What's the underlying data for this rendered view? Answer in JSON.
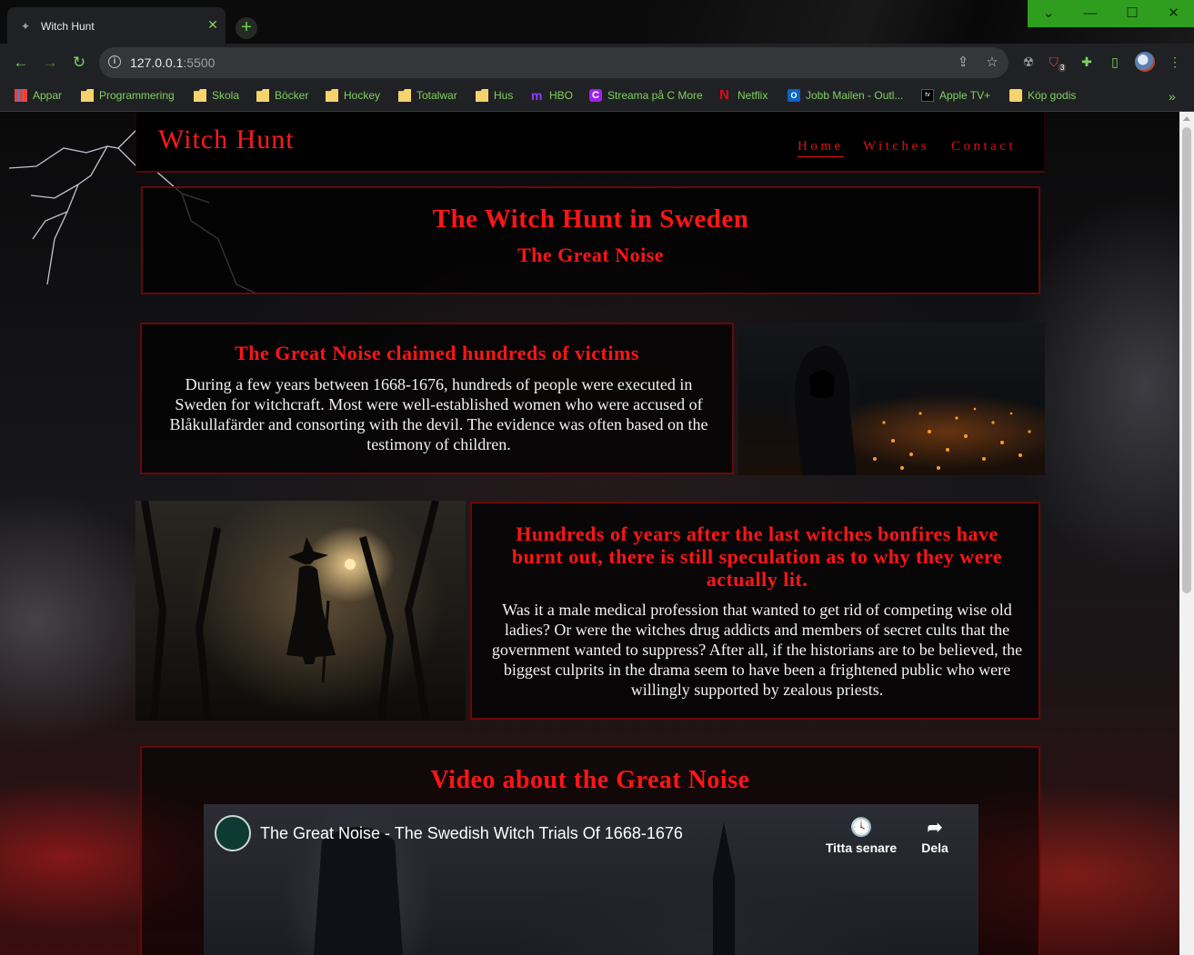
{
  "browser": {
    "tab_title": "Witch Hunt",
    "new_tab": "+",
    "url_host": "127.0.0.1",
    "url_port": ":5500",
    "bookmarks": [
      {
        "label": "Appar",
        "icon": "apps-grid-icon"
      },
      {
        "label": "Programmering",
        "icon": "folder-icon"
      },
      {
        "label": "Skola",
        "icon": "folder-icon"
      },
      {
        "label": "Böcker",
        "icon": "folder-icon"
      },
      {
        "label": "Hockey",
        "icon": "folder-icon"
      },
      {
        "label": "Totalwar",
        "icon": "folder-icon"
      },
      {
        "label": "Hus",
        "icon": "folder-icon"
      },
      {
        "label": "HBO",
        "icon": "hbo-icon"
      },
      {
        "label": "Streama på C More",
        "icon": "cmore-icon"
      },
      {
        "label": "Netflix",
        "icon": "netflix-icon"
      },
      {
        "label": "Jobb Mailen - Outl...",
        "icon": "outlook-icon"
      },
      {
        "label": "Apple TV+",
        "icon": "appletv-icon"
      },
      {
        "label": "Köp godis",
        "icon": "folder-icon"
      }
    ],
    "extension_badge": "3",
    "accent_color": "#6bd34a"
  },
  "site": {
    "brand": "Witch Hunt",
    "nav": [
      "Home",
      "Witches",
      "Contact"
    ],
    "hero": {
      "title": "The Witch Hunt in Sweden",
      "subtitle": "The Great Noise"
    },
    "section1": {
      "heading": "The Great Noise claimed hundreds of victims",
      "text": "During a few years between 1668-1676, hundreds of people were executed in Sweden for witchcraft. Most were well-established women who were accused of Blåkullafärder and consorting with the devil. The evidence was often based on the testimony of children."
    },
    "section2": {
      "heading": "Hundreds of years after the last witches bonfires have burnt out, there is still speculation as to why they were actually lit.",
      "text": "Was it a male medical profession that wanted to get rid of competing wise old ladies? Or were the witches drug addicts and members of secret cults that the government wanted to suppress? After all, if the historians are to be believed, the biggest culprits in the drama seem to have been a frightened public who were willingly supported by zealous priests."
    },
    "video": {
      "heading": "Video about the Great Noise",
      "title": "The Great Noise - The Swedish Witch Trials Of 1668-1676",
      "watch_later": "Titta senare",
      "share": "Dela"
    },
    "colors": {
      "accent_red": "#ff1515",
      "border_red": "#6a0707"
    }
  }
}
